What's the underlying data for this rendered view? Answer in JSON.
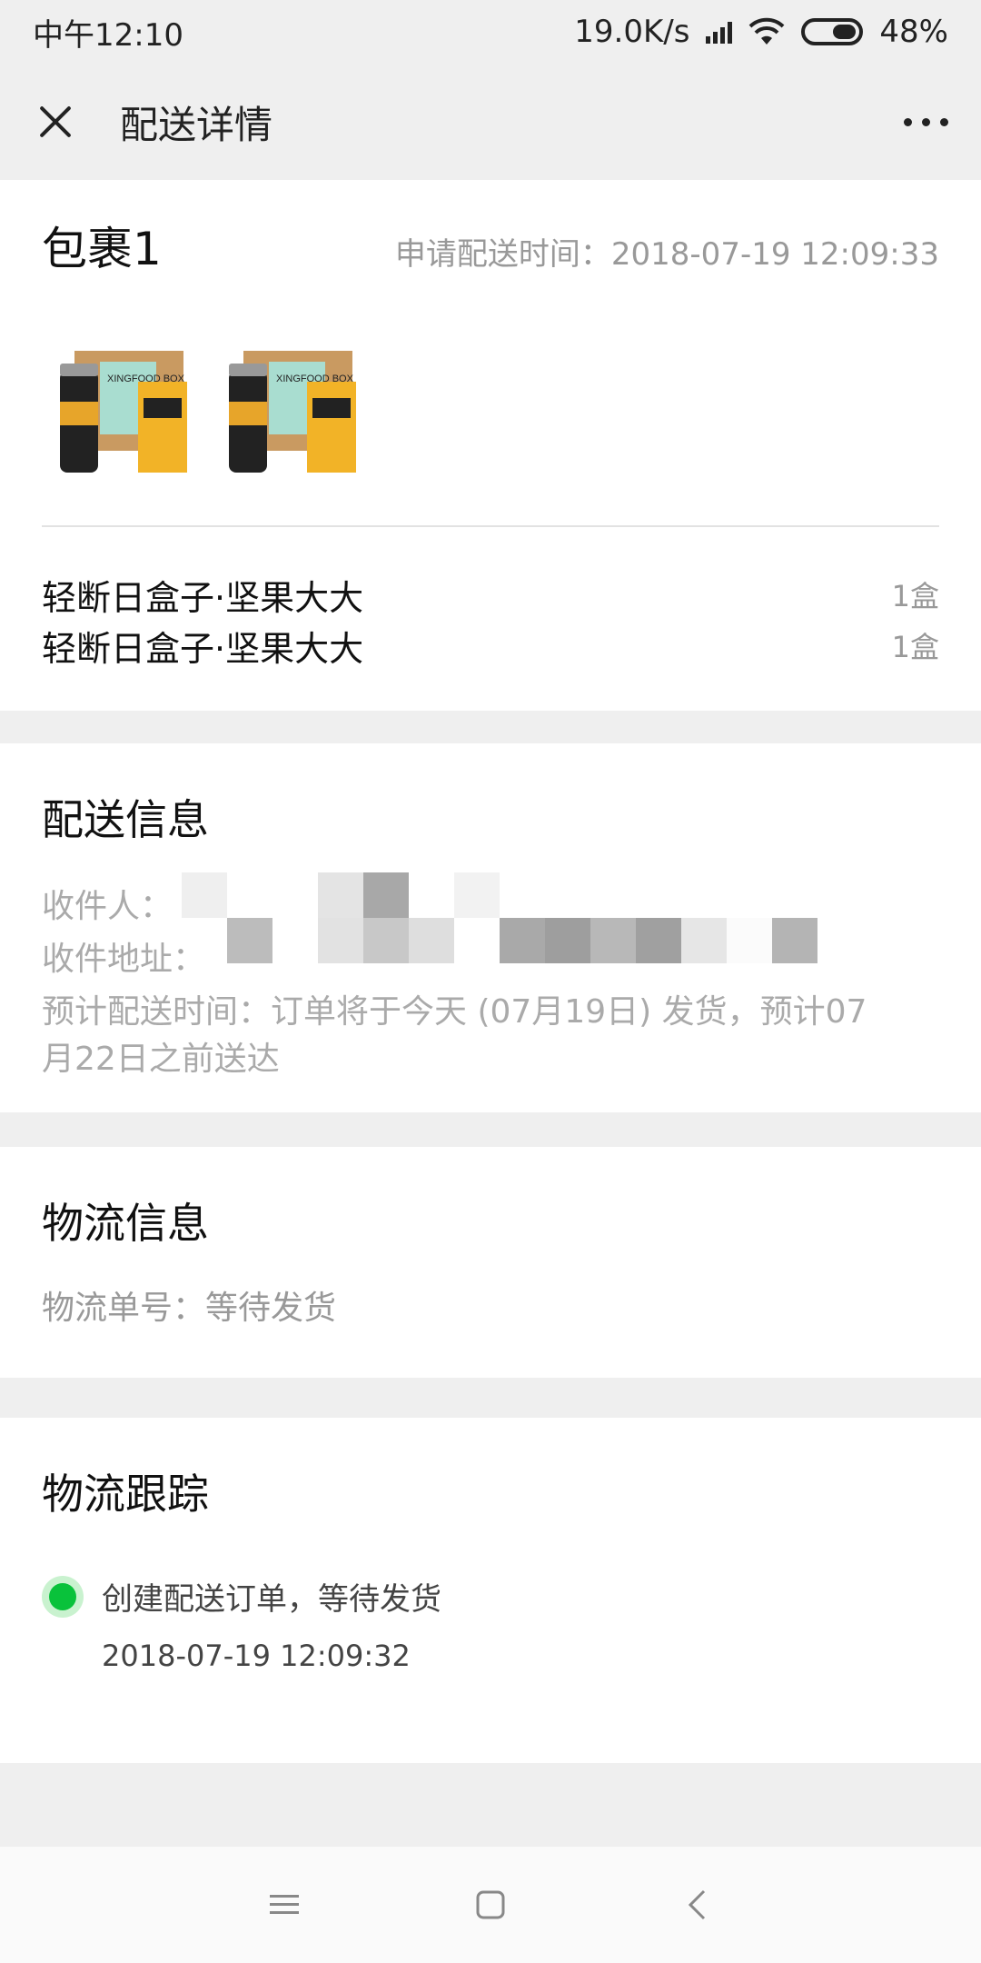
{
  "status_bar": {
    "time": "中午12:10",
    "net_speed": "19.0K/s",
    "battery": "48%",
    "battery_level": 0.48
  },
  "nav": {
    "title": "配送详情",
    "close_icon": "close-icon",
    "more_icon": "more-dots-icon"
  },
  "package": {
    "title": "包裹1",
    "request_time": "申请配送时间：2018-07-19 12:09:33",
    "thumb_brand": "XINGFOOD BOX",
    "items": [
      {
        "name": "轻断日盒子·坚果大大",
        "qty": "1盒"
      },
      {
        "name": "轻断日盒子·坚果大大",
        "qty": "1盒"
      }
    ]
  },
  "delivery": {
    "title": "配送信息",
    "recipient_label": "收件人：",
    "address_label": "收件地址：",
    "eta_line1": "预计配送时间：订单将于今天 (07月19日) 发货，预计07",
    "eta_line2": "月22日之前送达"
  },
  "logistics": {
    "title": "物流信息",
    "tracking_no": "物流单号：等待发货"
  },
  "tracking": {
    "title": "物流跟踪",
    "events": [
      {
        "desc": "创建配送订单，等待发货",
        "time": "2018-07-19 12:09:32",
        "color": "#09c23b"
      }
    ]
  },
  "system_nav": {
    "menu_icon": "menu-icon",
    "home_icon": "home-square-icon",
    "back_icon": "back-chevron-icon"
  }
}
